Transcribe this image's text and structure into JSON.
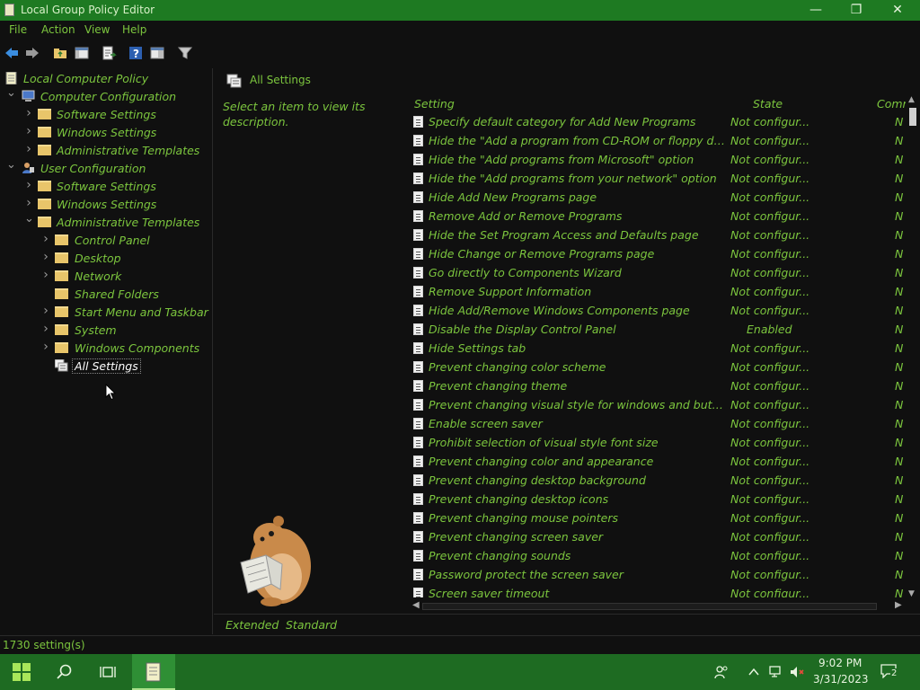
{
  "window": {
    "title": "Local Group Policy Editor",
    "minimize_glyph": "—",
    "maximize_glyph": "❐",
    "close_glyph": "✕"
  },
  "menu": [
    "File",
    "Action",
    "View",
    "Help"
  ],
  "tree": [
    {
      "label": "Local Computer Policy",
      "depth": 0,
      "chevron": "",
      "icon": "policy"
    },
    {
      "label": "Computer Configuration",
      "depth": 1,
      "chevron": "open",
      "icon": "computer"
    },
    {
      "label": "Software Settings",
      "depth": 2,
      "chevron": "closed",
      "icon": "folder"
    },
    {
      "label": "Windows Settings",
      "depth": 2,
      "chevron": "closed",
      "icon": "folder"
    },
    {
      "label": "Administrative Templates",
      "depth": 2,
      "chevron": "closed",
      "icon": "folder"
    },
    {
      "label": "User Configuration",
      "depth": 1,
      "chevron": "open",
      "icon": "user"
    },
    {
      "label": "Software Settings",
      "depth": 2,
      "chevron": "closed",
      "icon": "folder"
    },
    {
      "label": "Windows Settings",
      "depth": 2,
      "chevron": "closed",
      "icon": "folder"
    },
    {
      "label": "Administrative Templates",
      "depth": 2,
      "chevron": "open",
      "icon": "folder"
    },
    {
      "label": "Control Panel",
      "depth": 3,
      "chevron": "closed",
      "icon": "folder"
    },
    {
      "label": "Desktop",
      "depth": 3,
      "chevron": "closed",
      "icon": "folder"
    },
    {
      "label": "Network",
      "depth": 3,
      "chevron": "closed",
      "icon": "folder"
    },
    {
      "label": "Shared Folders",
      "depth": 3,
      "chevron": "",
      "icon": "folder"
    },
    {
      "label": "Start Menu and Taskbar",
      "depth": 3,
      "chevron": "closed",
      "icon": "folder"
    },
    {
      "label": "System",
      "depth": 3,
      "chevron": "closed",
      "icon": "folder"
    },
    {
      "label": "Windows Components",
      "depth": 3,
      "chevron": "closed",
      "icon": "folder"
    },
    {
      "label": "All Settings",
      "depth": 3,
      "chevron": "",
      "icon": "allsettings",
      "selected": true
    }
  ],
  "right": {
    "header": "All Settings",
    "description": "Select an item to view its description.",
    "columns": {
      "setting": "Setting",
      "state": "State",
      "comment": "Comm"
    },
    "rows": [
      {
        "name": "Specify default category for Add New Programs",
        "state": "Not configur...",
        "comment": "N"
      },
      {
        "name": "Hide the \"Add a program from CD-ROM or floppy dis...",
        "state": "Not configur...",
        "comment": "N"
      },
      {
        "name": "Hide the \"Add programs from Microsoft\" option",
        "state": "Not configur...",
        "comment": "N"
      },
      {
        "name": "Hide the \"Add programs from your network\" option",
        "state": "Not configur...",
        "comment": "N"
      },
      {
        "name": "Hide Add New Programs page",
        "state": "Not configur...",
        "comment": "N"
      },
      {
        "name": "Remove Add or Remove Programs",
        "state": "Not configur...",
        "comment": "N"
      },
      {
        "name": "Hide the Set Program Access and Defaults page",
        "state": "Not configur...",
        "comment": "N"
      },
      {
        "name": "Hide Change or Remove Programs page",
        "state": "Not configur...",
        "comment": "N"
      },
      {
        "name": "Go directly to Components Wizard",
        "state": "Not configur...",
        "comment": "N"
      },
      {
        "name": "Remove Support Information",
        "state": "Not configur...",
        "comment": "N"
      },
      {
        "name": "Hide Add/Remove Windows Components page",
        "state": "Not configur...",
        "comment": "N"
      },
      {
        "name": "Disable the Display Control Panel",
        "state": "Enabled",
        "comment": "N"
      },
      {
        "name": "Hide Settings tab",
        "state": "Not configur...",
        "comment": "N"
      },
      {
        "name": "Prevent changing color scheme",
        "state": "Not configur...",
        "comment": "N"
      },
      {
        "name": "Prevent changing theme",
        "state": "Not configur...",
        "comment": "N"
      },
      {
        "name": "Prevent changing visual style for windows and butto...",
        "state": "Not configur...",
        "comment": "N"
      },
      {
        "name": "Enable screen saver",
        "state": "Not configur...",
        "comment": "N"
      },
      {
        "name": "Prohibit selection of visual style font size",
        "state": "Not configur...",
        "comment": "N"
      },
      {
        "name": "Prevent changing color and appearance",
        "state": "Not configur...",
        "comment": "N"
      },
      {
        "name": "Prevent changing desktop background",
        "state": "Not configur...",
        "comment": "N"
      },
      {
        "name": "Prevent changing desktop icons",
        "state": "Not configur...",
        "comment": "N"
      },
      {
        "name": "Prevent changing mouse pointers",
        "state": "Not configur...",
        "comment": "N"
      },
      {
        "name": "Prevent changing screen saver",
        "state": "Not configur...",
        "comment": "N"
      },
      {
        "name": "Prevent changing sounds",
        "state": "Not configur...",
        "comment": "N"
      },
      {
        "name": "Password protect the screen saver",
        "state": "Not configur...",
        "comment": "N"
      },
      {
        "name": "Screen saver timeout",
        "state": "Not configur...",
        "comment": "N"
      }
    ],
    "tabs": {
      "extended": "Extended",
      "standard": "Standard"
    }
  },
  "status": {
    "text": "1730 setting(s)"
  },
  "taskbar": {
    "time": "9:02 PM",
    "date": "3/31/2023",
    "notification_count": "2"
  },
  "colors": {
    "accent": "#1E7A22",
    "text": "#7CC63E",
    "background": "#101010"
  }
}
